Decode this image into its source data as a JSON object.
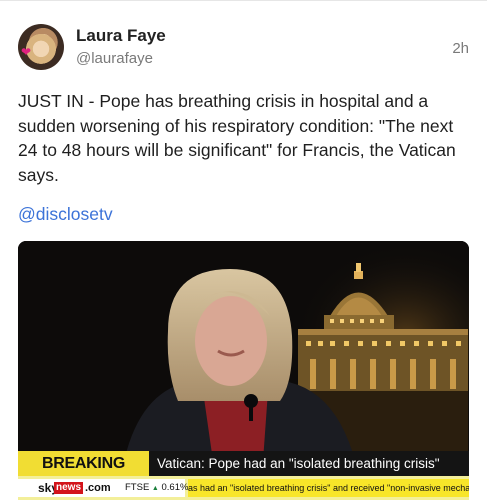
{
  "post": {
    "author_name": "Laura Faye",
    "handle": "@laurafaye",
    "time": "2h",
    "text": "JUST IN - Pope has breathing crisis in hospital and a sudden worsening of his respiratory condition: \"The next 24 to 48 hours will be significant\" for Francis, the Vatican says.",
    "mention": "@disclosetv"
  },
  "video": {
    "breaking_label": "BREAKING NEWS",
    "headline": "Vatican: Pope had an \"isolated breathing crisis\"",
    "logo_sky": "sky",
    "logo_news": "news",
    "logo_com": ".com",
    "ftse_label": "FTSE",
    "ftse_arrow": "▲",
    "ftse_change": "0.61%",
    "scroll_text": "as had an \"isolated breathing crisis\" and received \"non-invasive mechan"
  },
  "colors": {
    "link": "#3c73d8",
    "breaking_yellow": "#f1dd33",
    "sky_red": "#d3131a"
  }
}
